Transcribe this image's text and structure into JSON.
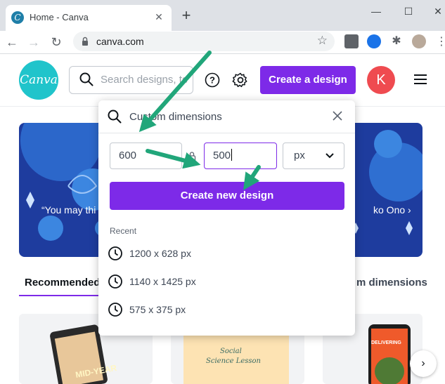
{
  "browser": {
    "tab_title": "Home - Canva",
    "tab_close": "✕",
    "new_tab": "+",
    "url": "canva.com",
    "window_controls": {
      "minimize": "—",
      "maximize": "☐",
      "close": "✕"
    }
  },
  "header": {
    "logo_text": "Canva",
    "search_placeholder": "Search designs, te",
    "create_button": "Create a design",
    "avatar_initial": "K"
  },
  "hero": {
    "quote": "“You may thi",
    "author": "ko Ono ›"
  },
  "tabs": {
    "recommended": "Recommended",
    "custom_dimensions": "m dimensions"
  },
  "cards": {
    "card1_text": "MID-YEAR",
    "card2_line1": "Social",
    "card2_line2": "Science Lesson",
    "card3_text": "DELIVERING"
  },
  "panel": {
    "title": "Custom dimensions",
    "width_value": "600",
    "height_value": "500",
    "unit": "px",
    "create_button": "Create new design",
    "recent_label": "Recent",
    "recent": [
      {
        "label": "1200 x 628 px"
      },
      {
        "label": "1140 x 1425 px"
      },
      {
        "label": "575 x 375 px"
      }
    ]
  },
  "colors": {
    "brand_purple": "#7d2ae8",
    "canva_teal": "#20c4cb",
    "avatar_red": "#ef4b50",
    "hero_blue": "#1e3c9e",
    "annotation_green": "#21a67a"
  }
}
